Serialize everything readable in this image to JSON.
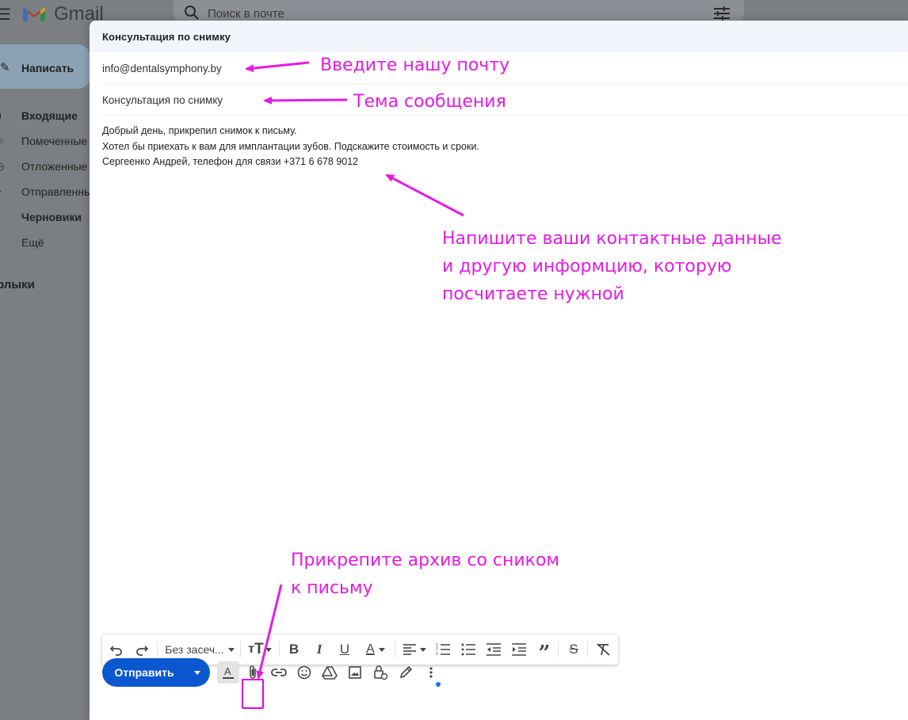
{
  "app": {
    "brand": "Gmail",
    "search_placeholder": "Поиск в почте",
    "compose_label": "Написать",
    "nav": [
      {
        "label": "Входящие",
        "icon": "inbox-icon",
        "bold": true
      },
      {
        "label": "Помеченные",
        "icon": "star-icon",
        "bold": false
      },
      {
        "label": "Отложенные",
        "icon": "clock-icon",
        "bold": false
      },
      {
        "label": "Отправленные",
        "icon": "send-icon",
        "bold": false
      },
      {
        "label": "Черновики",
        "icon": "draft-icon",
        "bold": true
      },
      {
        "label": "Ещё",
        "icon": "chevron-down-icon",
        "bold": false
      }
    ],
    "labels_title": "рлыки"
  },
  "compose": {
    "title": "Консультация по снимку",
    "to": "info@dentalsymphony.by",
    "subject": "Консультация по снимку",
    "body_lines": [
      "Добрый день, прикрепил снимок к письму.",
      "Хотел бы приехать к вам для имплантации зубов. Подскажите стоимость и сроки.",
      "Сергеенко Андрей, телефон для связи +371 6 678 9012"
    ]
  },
  "toolbar": {
    "font": "Без засеч...",
    "buttons": [
      "undo-icon",
      "redo-icon",
      "font-size-icon",
      "bold-icon",
      "italic-icon",
      "underline-icon",
      "text-color-icon",
      "align-icon",
      "numbered-list-icon",
      "bulleted-list-icon",
      "indent-less-icon",
      "indent-more-icon",
      "quote-icon",
      "strikethrough-icon",
      "remove-formatting-icon"
    ]
  },
  "bottom_bar": {
    "send_label": "Отправить",
    "icons": [
      "formatting-options-icon",
      "attach-icon",
      "link-icon",
      "emoji-icon",
      "drive-icon",
      "photo-icon",
      "confidential-icon",
      "signature-icon",
      "more-options-icon"
    ]
  },
  "annotations": {
    "email": "Введите нашу почту",
    "subject": "Тема сообщения",
    "contacts_lines": [
      "Напишите ваши контактные данные",
      "и другую информцию, которую",
      "посчитаете нужной"
    ],
    "attach_lines": [
      "Прикрепите архив со сником",
      "к письму"
    ]
  },
  "colors": {
    "annotation": "#e41be4",
    "send_button": "#0b57d0",
    "header_bg": "#f2f6fc"
  }
}
